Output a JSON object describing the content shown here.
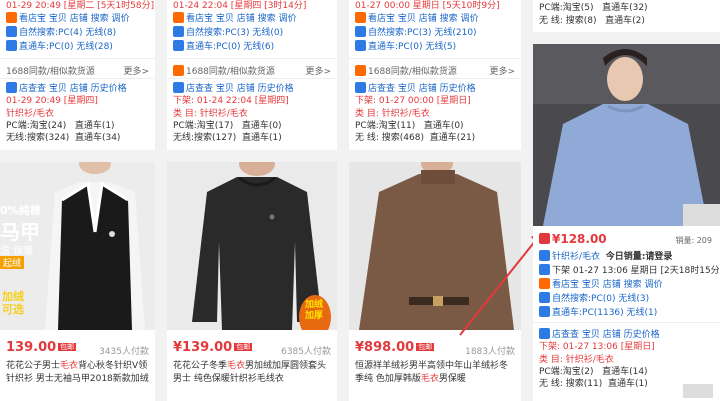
{
  "col1_top": {
    "time": "01-29 20:49 [星期二 [5天1时58分]",
    "store_links": "看店宝 宝贝 店铺 搜索 调价",
    "natural_search": "自然搜索:PC(4) 无线(8)",
    "direct_train": "直通车:PC(0) 无线(28)",
    "similar": "1688同款/相似款货源",
    "more": "更多>",
    "tools": "店查查 宝贝 店铺 历史价格",
    "down": "01-29 20:49 [星期四]",
    "category": "针织衫/毛衣",
    "pc": "PC端:淘宝(24)",
    "pc_train": "直通车(1)",
    "wireless": "无线:搜索(324)",
    "wireless_train": "直通车(34)"
  },
  "col2_top": {
    "time": "01-24 22:04 [星期四 [3时14分]",
    "store_links": "看店宝 宝贝 店铺 搜索 调价",
    "natural_search": "自然搜索:PC(3) 无线(0)",
    "direct_train": "直通车:PC(0) 无线(6)",
    "similar": "1688同款/相似款货源",
    "more": "更多>",
    "tools": "店查查 宝贝 店铺 历史价格",
    "down": "下架: 01-24 22:04 [星期四]",
    "category": "类 目: 针织衫/毛衣",
    "pc": "PC端:淘宝(17)",
    "pc_train": "直通车(0)",
    "wireless": "无线:搜索(127)",
    "wireless_train": "直通车(1)"
  },
  "col3_top": {
    "time": "01-27 00:00 星期日 [5天10时9分]",
    "store_links": "看店宝 宝贝 店铺 搜索 调价",
    "natural_search": "自然搜索:PC(3) 无线(210)",
    "direct_train": "直通车:PC(0) 无线(5)",
    "similar": "1688同款/相似款货源",
    "more": "更多>",
    "tools": "店查查 宝贝 店铺 历史价格",
    "down": "下架: 01-27 00:00 [星期日]",
    "category": "类 目: 针织衫/毛衣",
    "pc": "PC端:淘宝(11)",
    "pc_train": "直通车(0)",
    "wireless": "无 线: 搜索(468)",
    "wireless_train": "直通车(21)"
  },
  "col4_top": {
    "line1": "PC端:淘宝(5)",
    "line1b": "直通车(32)",
    "line2": "无 线: 搜索(8)",
    "line2b": "直通车(2)"
  },
  "products": [
    {
      "price": "139.00",
      "tag": "包邮",
      "sold": "3435人付款",
      "title_pre": "花花公子男士",
      "title_hl": "毛衣",
      "title_post": "背心秋冬针织V领针织衫 男士无袖马甲2018新款加绒",
      "promo_text": [
        "0%纯棉",
        "马甲",
        "温 保暖",
        "起绒",
        "加绒",
        "可选"
      ]
    },
    {
      "price": "139.00",
      "tag": "包邮",
      "sold": "6385人付款",
      "title_pre": "花花公子冬季",
      "title_hl": "毛衣",
      "title_post": "男加绒加厚圆领套头男士 纯色保暖针织衫毛线衣",
      "promo_text": [
        "加绒",
        "加厚"
      ]
    },
    {
      "price": "898.00",
      "tag": "包邮",
      "sold": "1883人付款",
      "title_pre": "恒源祥羊绒衫男半高领中年山羊绒衫冬季纯 色加厚韩版",
      "title_hl": "毛衣",
      "title_post": "男保暖"
    }
  ],
  "featured": {
    "price": "¥128.00",
    "sales_label": "销量: 209",
    "category": "针织衫/毛衣",
    "today_sales": "今日销量:请登录",
    "down": "下架 01-27 13:06 星期日 [2天18时15分]",
    "store_links": "看店宝 宝贝 店铺 搜索 调价",
    "natural_search": "自然搜索:PC(0) 无线(3)",
    "direct_train": "直通车:PC(1136) 无线(1)",
    "tools": "店查查 宝贝 店铺 历史价格",
    "down2": "下架: 01-27 13:06 [星期日]",
    "category2": "类 目: 针织衫/毛衣",
    "pc": "PC端:淘宝(2)",
    "pc_train": "直通车(14)",
    "wireless": "无 线: 搜索(11)",
    "wireless_train": "直通车(1)"
  },
  "colors": {
    "accent_red": "#e4393c",
    "link_blue": "#1a66c9",
    "badge_orange": "#ff6a00"
  }
}
